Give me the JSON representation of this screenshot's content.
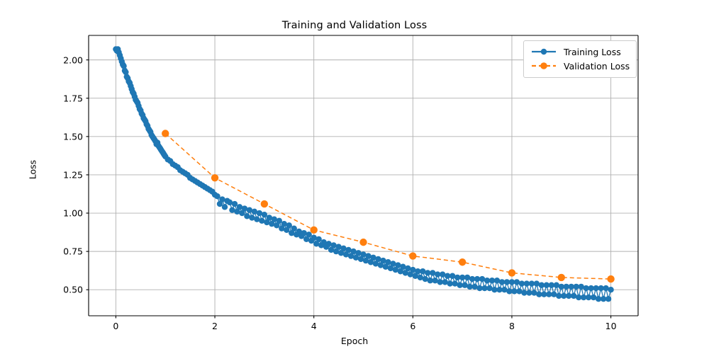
{
  "chart_data": {
    "type": "scatter",
    "title": "Training and Validation Loss",
    "xlabel": "Epoch",
    "ylabel": "Loss",
    "xlim": [
      -0.55,
      10.55
    ],
    "ylim": [
      0.33,
      2.16
    ],
    "grid": true,
    "legend_position": "upper right",
    "xticks": [
      0,
      2,
      4,
      6,
      8,
      10
    ],
    "xtick_labels": [
      "0",
      "2",
      "4",
      "6",
      "8",
      "10"
    ],
    "yticks": [
      0.5,
      0.75,
      1.0,
      1.25,
      1.5,
      1.75,
      2.0
    ],
    "ytick_labels": [
      "0.50",
      "0.75",
      "1.00",
      "1.25",
      "1.50",
      "1.75",
      "2.00"
    ],
    "colors": {
      "training": "#1f77b4",
      "validation": "#ff7f0e",
      "grid": "#b0b0b0",
      "axes": "#000000",
      "background": "#ffffff"
    },
    "series": [
      {
        "name": "Training Loss",
        "color": "#1f77b4",
        "linestyle": "solid",
        "marker": "circle",
        "x": [
          0.0,
          0.02,
          0.04,
          0.06,
          0.08,
          0.1,
          0.12,
          0.14,
          0.16,
          0.18,
          0.2,
          0.22,
          0.24,
          0.26,
          0.28,
          0.3,
          0.32,
          0.34,
          0.36,
          0.38,
          0.4,
          0.42,
          0.44,
          0.46,
          0.48,
          0.5,
          0.52,
          0.54,
          0.56,
          0.58,
          0.6,
          0.62,
          0.64,
          0.66,
          0.68,
          0.7,
          0.72,
          0.74,
          0.76,
          0.78,
          0.8,
          0.82,
          0.84,
          0.86,
          0.88,
          0.9,
          0.92,
          0.94,
          0.96,
          0.98,
          1.0,
          1.05,
          1.1,
          1.15,
          1.2,
          1.25,
          1.3,
          1.35,
          1.4,
          1.45,
          1.5,
          1.55,
          1.6,
          1.65,
          1.7,
          1.75,
          1.8,
          1.85,
          1.9,
          1.95,
          2.0,
          2.05,
          2.1,
          2.15,
          2.2,
          2.25,
          2.3,
          2.35,
          2.4,
          2.45,
          2.5,
          2.55,
          2.6,
          2.65,
          2.7,
          2.75,
          2.8,
          2.85,
          2.9,
          2.95,
          3.0,
          3.05,
          3.1,
          3.15,
          3.2,
          3.25,
          3.3,
          3.35,
          3.4,
          3.45,
          3.5,
          3.55,
          3.6,
          3.65,
          3.7,
          3.75,
          3.8,
          3.85,
          3.9,
          3.95,
          4.0,
          4.05,
          4.1,
          4.15,
          4.2,
          4.25,
          4.3,
          4.35,
          4.4,
          4.45,
          4.5,
          4.55,
          4.6,
          4.65,
          4.7,
          4.75,
          4.8,
          4.85,
          4.9,
          4.95,
          5.0,
          5.05,
          5.1,
          5.15,
          5.2,
          5.25,
          5.3,
          5.35,
          5.4,
          5.45,
          5.5,
          5.55,
          5.6,
          5.65,
          5.7,
          5.75,
          5.8,
          5.85,
          5.9,
          5.95,
          6.0,
          6.05,
          6.1,
          6.15,
          6.2,
          6.25,
          6.3,
          6.35,
          6.4,
          6.45,
          6.5,
          6.55,
          6.6,
          6.65,
          6.7,
          6.75,
          6.8,
          6.85,
          6.9,
          6.95,
          7.0,
          7.05,
          7.1,
          7.15,
          7.2,
          7.25,
          7.3,
          7.35,
          7.4,
          7.45,
          7.5,
          7.55,
          7.6,
          7.65,
          7.7,
          7.75,
          7.8,
          7.85,
          7.9,
          7.95,
          8.0,
          8.05,
          8.1,
          8.15,
          8.2,
          8.25,
          8.3,
          8.35,
          8.4,
          8.45,
          8.5,
          8.55,
          8.6,
          8.65,
          8.7,
          8.75,
          8.8,
          8.85,
          8.9,
          8.95,
          9.0,
          9.05,
          9.1,
          9.15,
          9.2,
          9.25,
          9.3,
          9.35,
          9.4,
          9.45,
          9.5,
          9.55,
          9.6,
          9.65,
          9.7,
          9.75,
          9.8,
          9.85,
          9.9,
          9.95,
          10.0
        ],
        "y": [
          2.07,
          2.06,
          2.07,
          2.05,
          2.03,
          2.01,
          1.99,
          1.97,
          1.96,
          1.93,
          1.92,
          1.89,
          1.88,
          1.86,
          1.85,
          1.83,
          1.81,
          1.79,
          1.78,
          1.76,
          1.74,
          1.73,
          1.72,
          1.7,
          1.68,
          1.67,
          1.65,
          1.64,
          1.62,
          1.61,
          1.6,
          1.58,
          1.57,
          1.55,
          1.54,
          1.53,
          1.51,
          1.5,
          1.49,
          1.48,
          1.47,
          1.45,
          1.46,
          1.44,
          1.43,
          1.42,
          1.41,
          1.4,
          1.39,
          1.38,
          1.37,
          1.35,
          1.34,
          1.32,
          1.31,
          1.3,
          1.28,
          1.27,
          1.26,
          1.25,
          1.23,
          1.22,
          1.21,
          1.2,
          1.19,
          1.18,
          1.17,
          1.16,
          1.15,
          1.14,
          1.12,
          1.11,
          1.06,
          1.09,
          1.04,
          1.08,
          1.07,
          1.02,
          1.06,
          1.01,
          1.04,
          1.0,
          1.03,
          0.98,
          1.02,
          0.97,
          1.01,
          0.96,
          1.0,
          0.95,
          0.99,
          0.94,
          0.97,
          0.93,
          0.96,
          0.92,
          0.95,
          0.9,
          0.93,
          0.89,
          0.92,
          0.87,
          0.9,
          0.86,
          0.88,
          0.85,
          0.87,
          0.83,
          0.86,
          0.82,
          0.84,
          0.8,
          0.83,
          0.79,
          0.81,
          0.78,
          0.8,
          0.76,
          0.79,
          0.75,
          0.78,
          0.74,
          0.77,
          0.73,
          0.76,
          0.72,
          0.75,
          0.71,
          0.74,
          0.7,
          0.73,
          0.69,
          0.72,
          0.68,
          0.71,
          0.67,
          0.7,
          0.66,
          0.69,
          0.65,
          0.68,
          0.64,
          0.67,
          0.63,
          0.66,
          0.62,
          0.65,
          0.61,
          0.64,
          0.6,
          0.63,
          0.59,
          0.62,
          0.58,
          0.62,
          0.57,
          0.61,
          0.56,
          0.61,
          0.56,
          0.6,
          0.55,
          0.6,
          0.55,
          0.59,
          0.54,
          0.59,
          0.54,
          0.58,
          0.53,
          0.58,
          0.53,
          0.58,
          0.52,
          0.57,
          0.52,
          0.57,
          0.51,
          0.57,
          0.51,
          0.56,
          0.51,
          0.56,
          0.5,
          0.56,
          0.5,
          0.55,
          0.5,
          0.55,
          0.49,
          0.55,
          0.49,
          0.55,
          0.49,
          0.54,
          0.48,
          0.54,
          0.48,
          0.54,
          0.48,
          0.54,
          0.47,
          0.53,
          0.47,
          0.53,
          0.47,
          0.53,
          0.47,
          0.53,
          0.46,
          0.52,
          0.46,
          0.52,
          0.46,
          0.52,
          0.46,
          0.52,
          0.45,
          0.52,
          0.45,
          0.51,
          0.45,
          0.51,
          0.45,
          0.51,
          0.44,
          0.51,
          0.44,
          0.51,
          0.44,
          0.5
        ]
      },
      {
        "name": "Validation Loss",
        "color": "#ff7f0e",
        "linestyle": "dashed",
        "marker": "circle",
        "x": [
          1,
          2,
          3,
          4,
          5,
          6,
          7,
          8,
          9,
          10
        ],
        "y": [
          1.52,
          1.23,
          1.06,
          0.89,
          0.81,
          0.72,
          0.68,
          0.61,
          0.58,
          0.57
        ]
      }
    ]
  },
  "legend": {
    "items": [
      {
        "label": "Training Loss"
      },
      {
        "label": "Validation Loss"
      }
    ]
  }
}
